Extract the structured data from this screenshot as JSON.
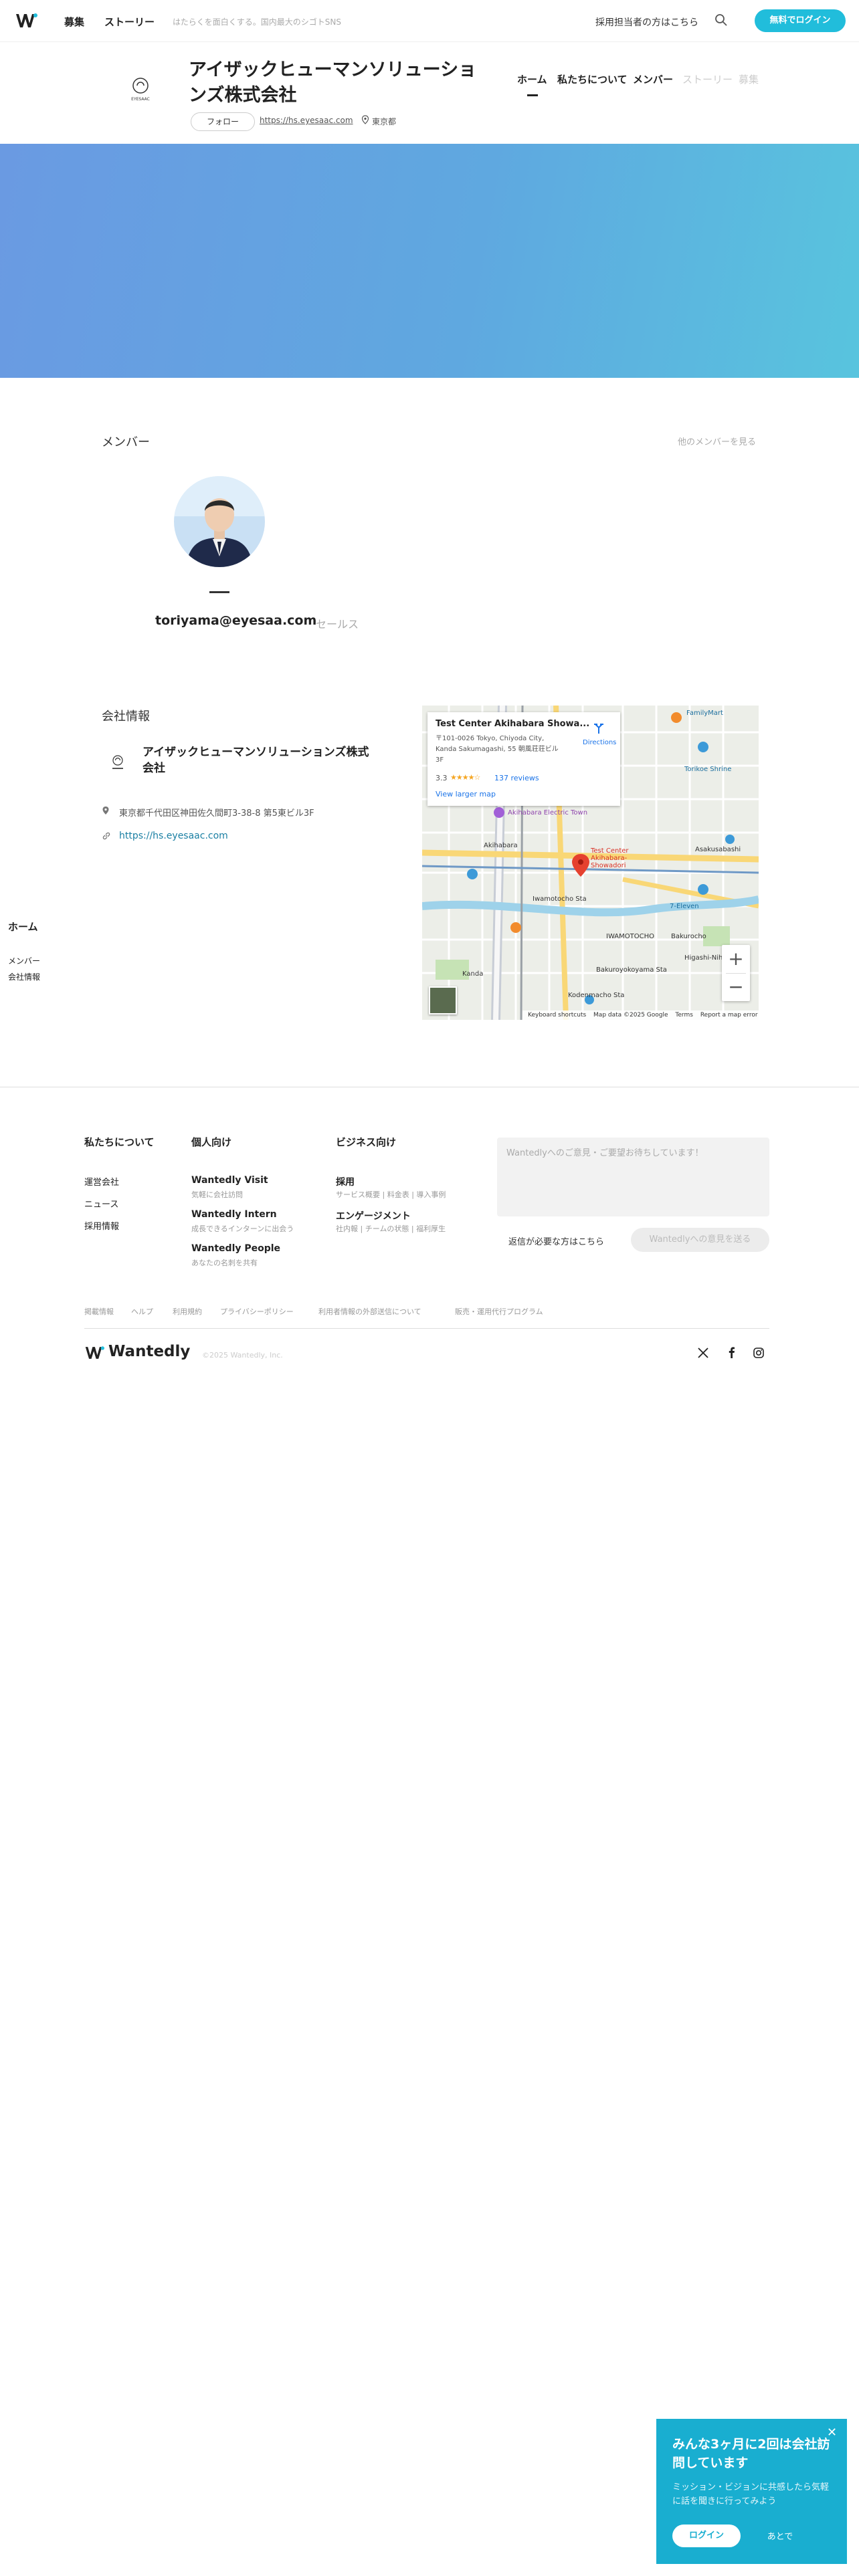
{
  "header": {
    "nav": [
      "募集",
      "ストーリー"
    ],
    "tagline": "はたらくを面白くする。国内最大のシゴトSNS",
    "recruiter_link": "採用担当者の方はこちら",
    "login_button": "無料でログイン",
    "brand_color": "#21bddb"
  },
  "company": {
    "name": "アイザックヒューマンソリューションズ株式会社",
    "follow": "フォロー",
    "url": "https://hs.eyesaac.com",
    "location": "東京都",
    "logo_text": "EYESAAC",
    "tabs": [
      "ホーム",
      "私たちについて",
      "メンバー",
      "ストーリー",
      "募集"
    ]
  },
  "members": {
    "title": "メンバー",
    "see_more": "他のメンバーを見る",
    "items": [
      {
        "email": "toriyama@eyesaa.com",
        "role": "セールス"
      }
    ]
  },
  "company_info": {
    "title": "会社情報",
    "name": "アイザックヒューマンソリューションズ株式会社",
    "address": "東京都千代田区神田佐久間町3-38-8 第5東ビル3F",
    "website": "https://hs.eyesaac.com"
  },
  "map": {
    "card_title": "Test Center Akihabara Showa...",
    "card_address": "〒101-0026 Tokyo, Chiyoda City, Kanda Sakumagashi, 55 朝風荘荘ビル 3F",
    "rating": "3.3",
    "stars": "★★★★☆",
    "reviews": "137 reviews",
    "directions": "Directions",
    "view_larger": "View larger map",
    "labels": {
      "akihabara_electric": "Akihabara Electric Town",
      "akihabara": "Akihabara",
      "test_center": "Test Center Akihabara-Showadori",
      "asakusabashi": "Asakusabashi",
      "family_mart": "FamilyMart",
      "tomioka": "Torikoe Shrine",
      "iwamotocho": "IWAMOTOCHO",
      "iwamotocho_sta": "Iwamotocho Sta",
      "bakuroyokoyama": "Bakuroyokoyama Sta",
      "bakurocho": "Bakurocho",
      "kodenmacho": "Kodenmacho Sta",
      "kanda": "Kanda",
      "seven_eleven": "7-Eleven",
      "higashi_nihonbashi": "Higashi-Nihonbashi"
    },
    "footer": [
      "Keyboard shortcuts",
      "Map data ©2025 Google",
      "Terms",
      "Report a map error"
    ]
  },
  "sidebar": {
    "home": "ホーム",
    "items": [
      "メンバー",
      "会社情報"
    ]
  },
  "footer": {
    "col1": {
      "title": "私たちについて",
      "links": [
        "運営会社",
        "ニュース",
        "採用情報"
      ]
    },
    "col2": {
      "title": "個人向け",
      "items": [
        {
          "name": "Wantedly Visit",
          "desc": "気軽に会社訪問"
        },
        {
          "name": "Wantedly Intern",
          "desc": "成長できるインターンに出会う"
        },
        {
          "name": "Wantedly People",
          "desc": "あなたの名刺を共有"
        }
      ]
    },
    "col3": {
      "title": "ビジネス向け",
      "items": [
        {
          "name": "採用",
          "desc": "サービス概要 | 料金表 | 導入事例"
        },
        {
          "name": "エンゲージメント",
          "desc": "社内報 | チームの状態 | 福利厚生"
        }
      ]
    },
    "feedback_placeholder": "Wantedlyへのご意見・ご要望お待ちしています！",
    "reply_link": "返信が必要な方はこちら",
    "send_button": "Wantedlyへの意見を送る",
    "small_links": [
      "掲載情報",
      "ヘルプ",
      "利用規約",
      "プライバシーポリシー",
      "利用者情報の外部送信について",
      "販売・運用代行プログラム"
    ],
    "wordmark": "Wantedly",
    "copyright": "©2025 Wantedly, Inc."
  },
  "popup": {
    "title": "みんな3ヶ月に2回は会社訪問しています",
    "desc": "ミッション・ビジョンに共感したら気軽に話を聞きに行ってみよう",
    "login": "ログイン",
    "later": "あとで",
    "color": "#19aed0"
  }
}
